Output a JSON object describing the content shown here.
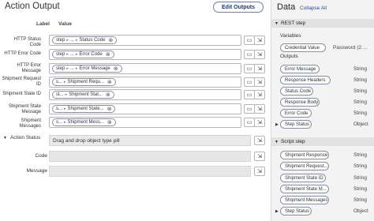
{
  "left": {
    "title": "Action Output",
    "edit_outputs_label": "Edit Outputs",
    "col_label": "Label",
    "col_value": "Value",
    "rows": [
      {
        "label": "HTTP Status Code",
        "pill": {
          "p1": "step",
          "p2": "...",
          "p3": "Status Code"
        }
      },
      {
        "label": "HTTP Error Code",
        "pill": {
          "p1": "step",
          "p2": "...",
          "p3": "Error Code"
        }
      },
      {
        "label": "HTTP Error Message",
        "pill": {
          "p1": "step",
          "p2": "...",
          "p3": "Error Message"
        }
      },
      {
        "label": "Shipment Request ID",
        "pill": {
          "p1": "s...",
          "p2": "",
          "p3": "Shipment Requ..."
        }
      },
      {
        "label": "Shipment State ID",
        "pill": {
          "p1": "st...",
          "p2": "",
          "p3": "Shipment Stat..."
        }
      },
      {
        "label": "Shipment State Message",
        "pill": {
          "p1": "s...",
          "p2": "",
          "p3": "Shipment State..."
        }
      },
      {
        "label": "Shipment Messages",
        "pill": {
          "p1": "s...",
          "p2": "",
          "p3": "Shipment Mess..."
        }
      }
    ],
    "action_status": {
      "label": "Action Status",
      "placeholder": "Drag and drop object type pill",
      "code_label": "Code",
      "message_label": "Message"
    }
  },
  "right": {
    "title": "Data",
    "collapse_all": "Collapse All",
    "rest_step": {
      "header": "REST step",
      "variables_label": "Variables",
      "variables": [
        {
          "name": "Credential Value",
          "type": "Password (2 ..."
        }
      ],
      "outputs_label": "Outputs",
      "outputs": [
        {
          "name": "Error Message",
          "type": "String"
        },
        {
          "name": "Response Headers",
          "type": "String"
        },
        {
          "name": "Status Code",
          "type": "String"
        },
        {
          "name": "Response Body",
          "type": "String"
        },
        {
          "name": "Error Code",
          "type": "String"
        },
        {
          "name": "Step Status",
          "type": "Object"
        }
      ]
    },
    "script_step": {
      "header": "Script step",
      "outputs": [
        {
          "name": "Shipment Response",
          "type": "String"
        },
        {
          "name": "Shipment Request...",
          "type": "String"
        },
        {
          "name": "Shipment State ID",
          "type": "String"
        },
        {
          "name": "Shipment State M...",
          "type": "String"
        },
        {
          "name": "Shipment Messages",
          "type": "String"
        },
        {
          "name": "Step Status",
          "type": "Object"
        }
      ]
    }
  }
}
